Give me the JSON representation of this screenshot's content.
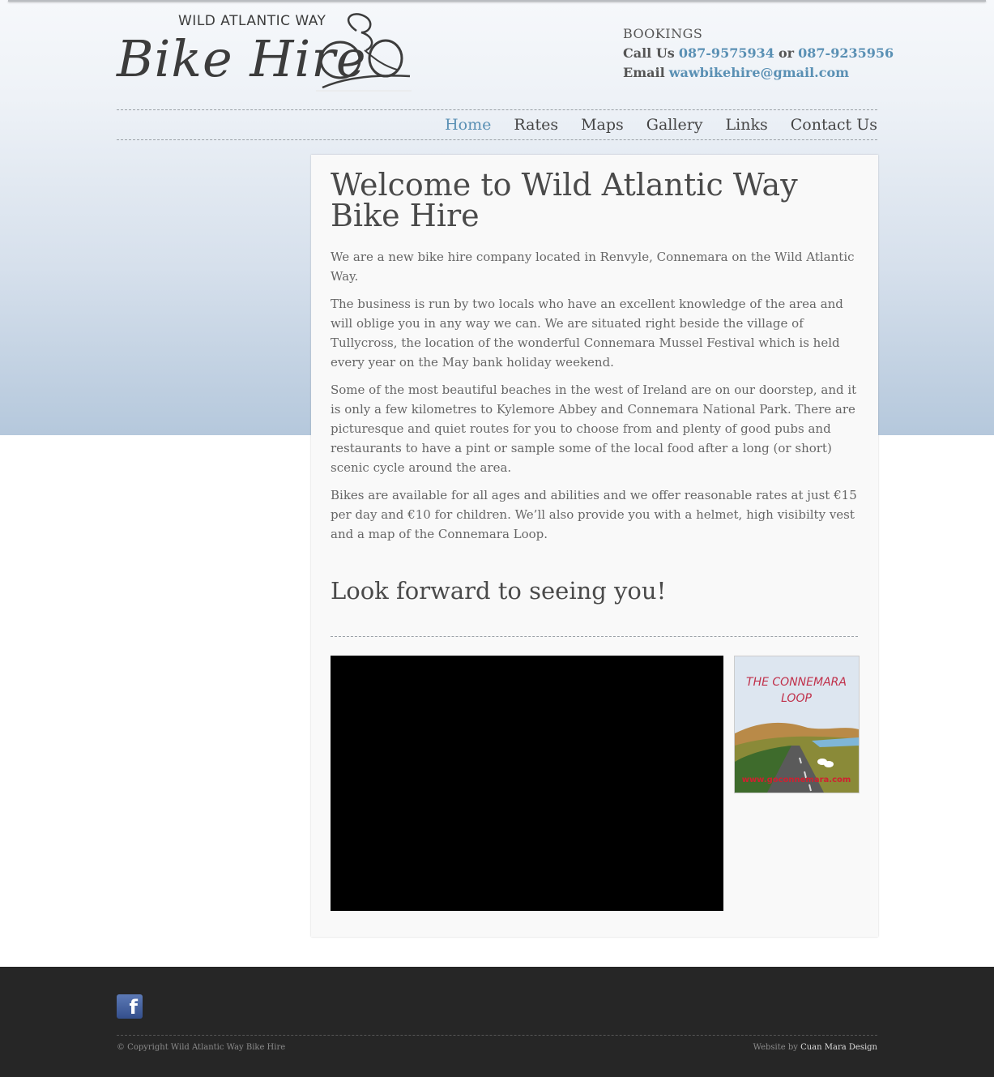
{
  "header": {
    "logo_small": "WILD ATLANTIC WAY",
    "logo_big": "Bike Hire",
    "bookings_title": "BOOKINGS",
    "call_label": "Call Us",
    "phone1": "087-9575934",
    "or_label": "or",
    "phone2": "087-9235956",
    "email_label": "Email",
    "email": "wawbikehire@gmail.com"
  },
  "nav": {
    "items": [
      {
        "label": "Home",
        "active": true
      },
      {
        "label": "Rates"
      },
      {
        "label": "Maps"
      },
      {
        "label": "Gallery"
      },
      {
        "label": "Links"
      },
      {
        "label": "Contact Us"
      }
    ]
  },
  "main": {
    "title": "Welcome to Wild Atlantic Way Bike Hire",
    "paragraphs": [
      "We are a new bike hire company located in Renvyle, Connemara on the Wild Atlantic Way.",
      "The business is run by two locals who have an excellent knowledge of the area and will oblige you in any way we can. We are situated right beside the village of Tullycross, the location of the wonderful Connemara Mussel Festival which is held every year on the May bank holiday weekend.",
      "Some of the most beautiful  beaches in the west of Ireland are on our doorstep, and it is only a few kilometres to Kylemore Abbey and Connemara National Park. There are picturesque and quiet routes for you to choose from and plenty of good pubs and restaurants to have a pint or sample some of the local food after a long (or short) scenic cycle around the area.",
      "Bikes are available for all ages and abilities and we offer reasonable rates at just €15 per day and €10 for children. We’ll also provide you with a helmet, high visibilty vest and  a map of the Connemara Loop."
    ],
    "subtitle": "Look forward to seeing you!",
    "map_title_line1": "THE CONNEMARA",
    "map_title_line2": "LOOP",
    "map_url": "www.goconnemara.com"
  },
  "footer": {
    "copyright": "© Copyright Wild Atlantic Way Bike Hire",
    "credit_prefix": "Website by",
    "credit_link": "Cuan Mara Design"
  },
  "colors": {
    "link_blue": "#5a90b4",
    "footer_bg": "#262626",
    "facebook_blue": "#3b5998"
  }
}
